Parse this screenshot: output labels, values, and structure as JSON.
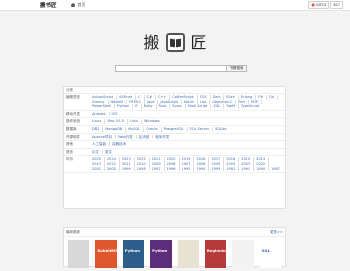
{
  "topbar": {
    "site_name": "搬书匠",
    "home_label": "首页",
    "github_label": "GITC2",
    "github_count": "827"
  },
  "hero": {
    "left_char": "搬",
    "right_char": "匠"
  },
  "search": {
    "placeholder": "",
    "button_label": "书籍搜索"
  },
  "categories": {
    "header": "分类",
    "rows": [
      {
        "label": "编程语言",
        "tags": [
          "ActionScript",
          "ASP.net",
          "C",
          "C#",
          "C++",
          "CoffeeScript",
          "CSS",
          "Dart",
          "Elixir",
          "Erlang",
          "F#",
          "Go",
          "Groovy",
          "Haskell",
          "HTML5",
          "Java",
          "JavaScript",
          "Kotlin",
          "Lua",
          "Objective-C",
          "Perl",
          "PHP",
          "PowerShell",
          "Python",
          "R",
          "Ruby",
          "Rust",
          "Scala",
          "Shell Script",
          "SQL",
          "Swift",
          "TypeScript"
        ]
      },
      {
        "label": "移动开发",
        "tags": [
          "Android",
          "iOS"
        ]
      },
      {
        "label": "操作系统",
        "tags": [
          "Linux",
          "Mac OS X",
          "Unix",
          "Windows"
        ]
      },
      {
        "label": "数据库",
        "tags": [
          "DB2",
          "MongoDB",
          "MySQL",
          "Oracle",
          "PostgreSQL",
          "SQL Server",
          "SQLite"
        ]
      },
      {
        "label": "开源软件",
        "tags": [
          "Apache项目",
          "Web开发",
          "区块链",
          "程序开发"
        ]
      },
      {
        "label": "其他",
        "tags": [
          "人工智能",
          "容器技术"
        ]
      },
      {
        "label": "语言",
        "tags": [
          "中文",
          "英文"
        ]
      },
      {
        "label": "年份",
        "tags": [
          "2025",
          "2024",
          "2023",
          "2022",
          "2021",
          "2020",
          "2019",
          "2018",
          "2017",
          "2016",
          "2015",
          "2014",
          "2013",
          "2012",
          "2011",
          "2010",
          "2009",
          "2008",
          "2007",
          "2006",
          "2005",
          "2004",
          "2003",
          "2002",
          "2001",
          "2000",
          "1999",
          "1998",
          "1997",
          "1996",
          "1995",
          "1994",
          "1993",
          "1992",
          "1991",
          "1990",
          "1987"
        ]
      }
    ]
  },
  "latest": {
    "header": "最新更新",
    "more_label": "更多>>",
    "books": [
      {
        "title": "",
        "color": "#d8d8d8"
      },
      {
        "title": "RabbitMQ",
        "color": "#e0572d"
      },
      {
        "title": "Python",
        "color": "#2d5d8a"
      },
      {
        "title": "Python",
        "color": "#5b2d7a"
      },
      {
        "title": "",
        "color": "#e8e2d2"
      },
      {
        "title": "Beginning",
        "color": "#b53a3a"
      },
      {
        "title": "",
        "color": "#f2f2f2"
      },
      {
        "title": "SQL",
        "color": "#ffffff"
      }
    ]
  }
}
